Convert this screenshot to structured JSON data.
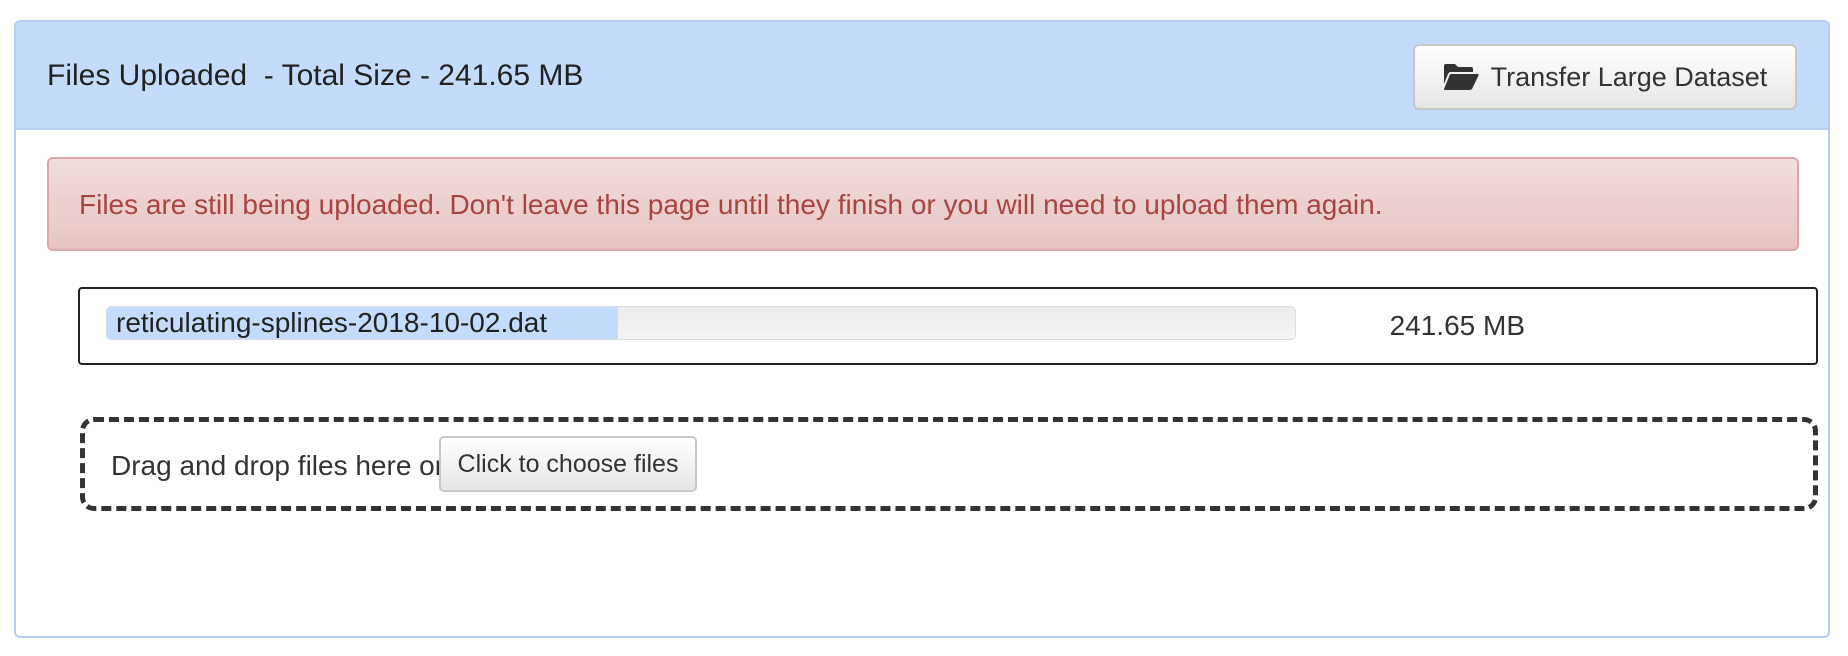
{
  "panel": {
    "title": "Files Uploaded  - Total Size - 241.65 MB",
    "transfer_button": {
      "label": "Transfer Large Dataset",
      "icon": "folder-open-icon"
    }
  },
  "alert": {
    "message": "Files are still being uploaded. Don't leave this page until they finish or you will need to upload them again."
  },
  "uploads": [
    {
      "filename": "reticulating-splines-2018-10-02.dat",
      "size": "241.65 MB",
      "progress_percent": 43
    }
  ],
  "dropzone": {
    "label": "Drag and drop files here or",
    "button_label": "Click to choose files"
  },
  "colors": {
    "header_bg": "#c5dbfb",
    "alert_text": "#a94442",
    "alert_bg": "#f2dede",
    "progress_fill": "#c5dbfb"
  }
}
